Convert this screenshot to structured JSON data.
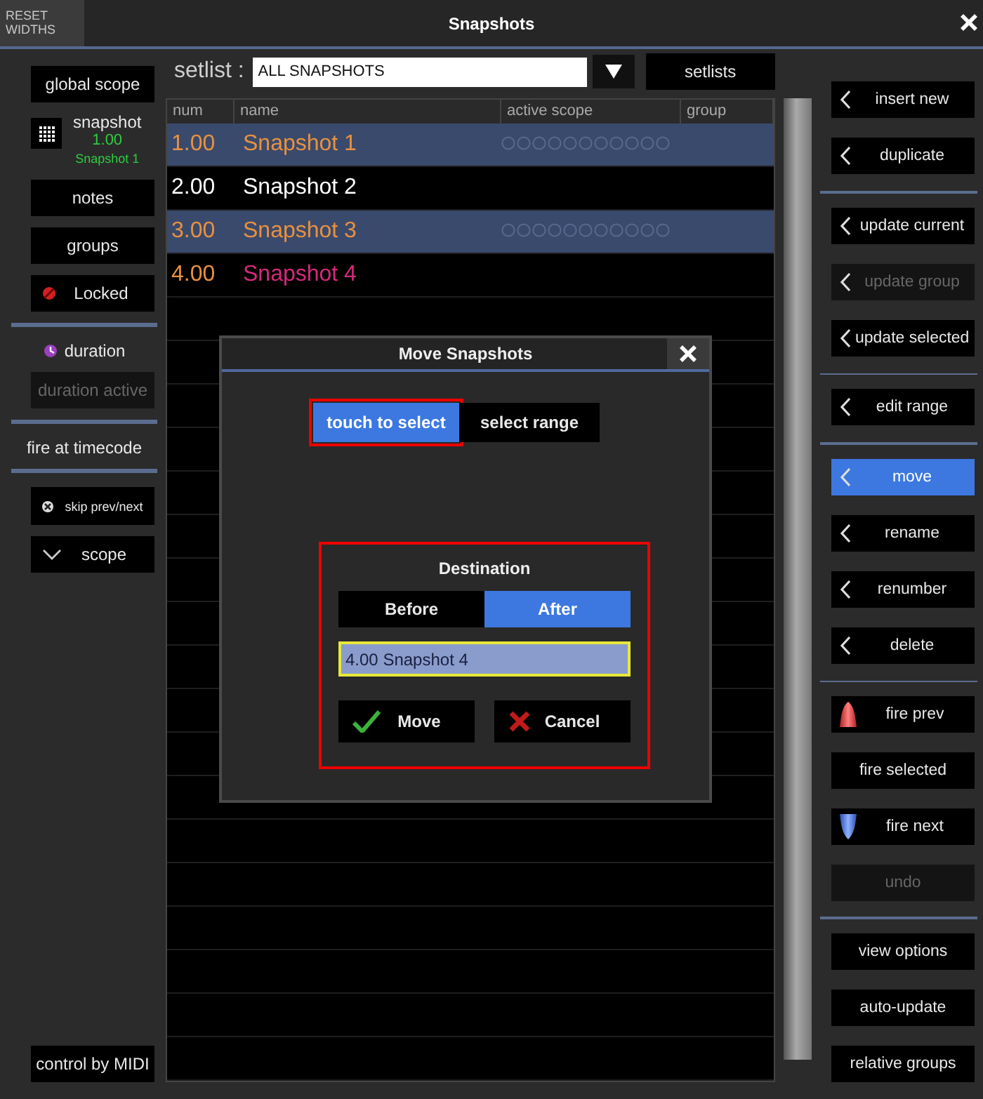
{
  "window": {
    "title": "Snapshots",
    "reset_button": "RESET WIDTHS"
  },
  "left_panel": {
    "groups": [
      [
        {
          "kind": "button",
          "label": "global scope",
          "disabled": false
        },
        {
          "kind": "snapshot",
          "label": "snapshot",
          "number": "1.00",
          "name": "Snapshot 1",
          "disabled": false
        },
        {
          "kind": "button",
          "label": "notes",
          "disabled": false
        },
        {
          "kind": "button",
          "label": "groups",
          "disabled": false
        },
        {
          "kind": "lock",
          "label": "Locked",
          "disabled": false
        }
      ],
      [
        {
          "kind": "clock",
          "label": "duration",
          "disabled": false
        },
        {
          "kind": "button",
          "label": "duration active",
          "disabled": true
        }
      ],
      [
        {
          "kind": "label",
          "label": "fire at timecode",
          "disabled": false
        }
      ],
      [
        {
          "kind": "skip",
          "label": "skip prev/next",
          "disabled": false
        },
        {
          "kind": "expand",
          "label": "scope",
          "disabled": false
        }
      ]
    ],
    "footer": {
      "label": "control by MIDI"
    }
  },
  "setlist": {
    "label": "setlist :",
    "value": "ALL SNAPSHOTS",
    "button": "setlists"
  },
  "table": {
    "columns": [
      "num",
      "name",
      "active scope",
      "group"
    ],
    "rows": [
      {
        "selected": true,
        "scope_dots": true,
        "cells": [
          {
            "text": "1.00",
            "color": "#e8913f"
          },
          {
            "text": "Snapshot 1",
            "color": "#e8913f"
          }
        ]
      },
      {
        "selected": false,
        "scope_dots": false,
        "cells": [
          {
            "text": "2.00",
            "color": "#ffffff"
          },
          {
            "text": "Snapshot 2",
            "color": "#ffffff"
          }
        ]
      },
      {
        "selected": true,
        "scope_dots": true,
        "cells": [
          {
            "text": "3.00",
            "color": "#e8913f"
          },
          {
            "text": "Snapshot 3",
            "color": "#e8913f"
          }
        ]
      },
      {
        "selected": false,
        "scope_dots": false,
        "cells": [
          {
            "text": "4.00",
            "color": "#e8913f"
          },
          {
            "text": "Snapshot 4",
            "color": "#d42a7c"
          }
        ]
      }
    ]
  },
  "right_panel": {
    "groups": [
      [
        {
          "kind": "chevron",
          "label": "insert new",
          "selected": false,
          "disabled": false
        },
        {
          "kind": "chevron",
          "label": "duplicate",
          "selected": false,
          "disabled": false
        }
      ],
      [
        {
          "kind": "chevron",
          "label": "update current",
          "selected": false,
          "disabled": false
        },
        {
          "kind": "chevron",
          "label": "update group",
          "selected": false,
          "disabled": true
        },
        {
          "kind": "chevron",
          "label": "update selected",
          "selected": false,
          "disabled": false
        }
      ],
      [
        {
          "kind": "chevron",
          "label": "edit range",
          "selected": false,
          "disabled": false
        }
      ],
      [
        {
          "kind": "chevron",
          "label": "move",
          "selected": true,
          "disabled": false
        },
        {
          "kind": "chevron",
          "label": "rename",
          "selected": false,
          "disabled": false
        },
        {
          "kind": "chevron",
          "label": "renumber",
          "selected": false,
          "disabled": false
        },
        {
          "kind": "chevron",
          "label": "delete",
          "selected": false,
          "disabled": false
        }
      ],
      [
        {
          "kind": "fire_prev",
          "label": "fire prev",
          "selected": false,
          "disabled": false
        },
        {
          "kind": "plain",
          "label": "fire selected",
          "selected": false,
          "disabled": false
        },
        {
          "kind": "fire_next",
          "label": "fire next",
          "selected": false,
          "disabled": false
        },
        {
          "kind": "plain",
          "label": "undo",
          "selected": false,
          "disabled": true
        }
      ],
      [
        {
          "kind": "plain",
          "label": "view options",
          "selected": false,
          "disabled": false
        },
        {
          "kind": "plain",
          "label": "auto-update",
          "selected": false,
          "disabled": false
        },
        {
          "kind": "plain",
          "label": "relative groups",
          "selected": false,
          "disabled": false
        }
      ]
    ]
  },
  "dialog": {
    "title": "Move Snapshots",
    "modes": [
      {
        "label": "touch to select",
        "selected": true,
        "highlighted": true
      },
      {
        "label": "select range",
        "selected": false,
        "highlighted": false
      }
    ],
    "destination": {
      "label": "Destination",
      "highlighted": true,
      "positions": [
        {
          "label": "Before",
          "selected": false
        },
        {
          "label": "After",
          "selected": true
        }
      ],
      "value": "4.00 Snapshot 4"
    },
    "buttons": [
      {
        "kind": "confirm",
        "label": "Move"
      },
      {
        "kind": "cancel",
        "label": "Cancel"
      }
    ]
  }
}
